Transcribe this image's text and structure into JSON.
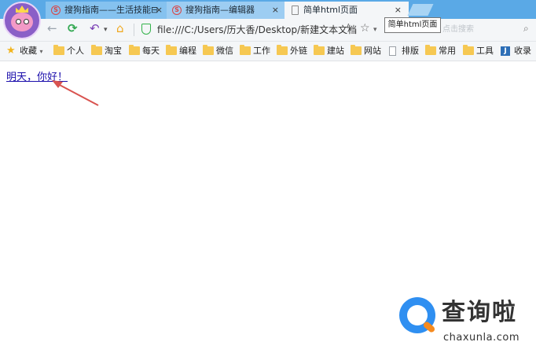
{
  "tabs": [
    {
      "label": "搜狗指南——生活技能⊟",
      "icon": "sogou-icon",
      "close": "×"
    },
    {
      "label": "搜狗指南—编辑器",
      "icon": "sogou-icon",
      "close": "×"
    },
    {
      "label": "简单html页面",
      "icon": "page-icon",
      "close": "×"
    }
  ],
  "toolbar": {
    "url": "file:///C:/Users/历大香/Desktop/新建文本文档",
    "search_placeholder": "点击搜索"
  },
  "tooltip": "简单html页面",
  "bookmarks": [
    {
      "label": "收藏",
      "icon": "star-icon"
    },
    {
      "label": "个人",
      "icon": "folder-icon"
    },
    {
      "label": "淘宝",
      "icon": "folder-icon"
    },
    {
      "label": "每天",
      "icon": "folder-icon"
    },
    {
      "label": "编程",
      "icon": "folder-icon"
    },
    {
      "label": "微信",
      "icon": "folder-icon"
    },
    {
      "label": "工作",
      "icon": "folder-icon"
    },
    {
      "label": "外链",
      "icon": "folder-icon"
    },
    {
      "label": "建站",
      "icon": "folder-icon"
    },
    {
      "label": "网站",
      "icon": "folder-icon"
    },
    {
      "label": "排版",
      "icon": "document-icon"
    },
    {
      "label": "常用",
      "icon": "folder-icon"
    },
    {
      "label": "工具",
      "icon": "folder-icon"
    },
    {
      "label": "收录",
      "icon": "j-icon"
    }
  ],
  "content": {
    "link_text": "明天，你好！"
  },
  "watermark": {
    "name": "查询啦",
    "domain": "chaxunla.com"
  },
  "colors": {
    "tab_strip": "#5aa9e6",
    "link": "#1a0dab",
    "arrow": "#d9534f",
    "watermark_blue": "#2f8ff1",
    "watermark_orange": "#f58a1f"
  }
}
